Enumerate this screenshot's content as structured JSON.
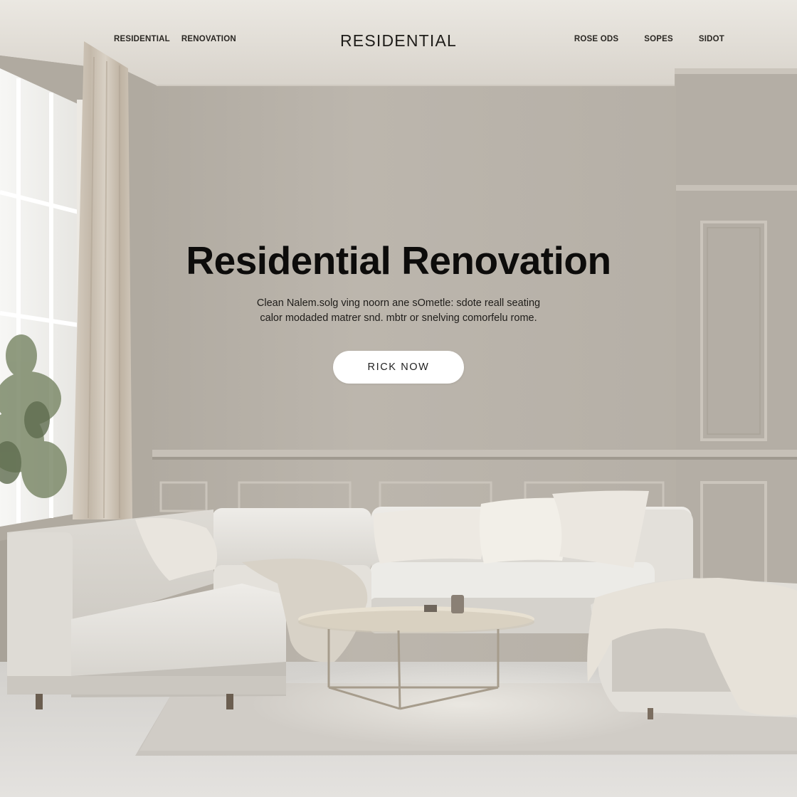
{
  "nav": {
    "left_links": [
      "RESIDENTIAL",
      "RENOVATION"
    ],
    "brand": "RESIDENTIAL",
    "right_links": [
      "ROSE ODS",
      "SOPES",
      "SIDOT"
    ]
  },
  "hero": {
    "title": "Residential Renovation",
    "subtitle_line1": "Clean Nalem.solg ving noorn ane sOmetle: sdote reall seating",
    "subtitle_line2": "calor modaded matrer snd. mbtr or snelving comorfelu rome.",
    "cta_label": "RICK NOW"
  },
  "colors": {
    "wall": "#b9b3aa",
    "ceiling": "#e1ddd6",
    "sofa": "#e7e4de",
    "floor": "#d9d7d3",
    "text": "#0d0c0b",
    "button_bg": "#ffffff"
  }
}
